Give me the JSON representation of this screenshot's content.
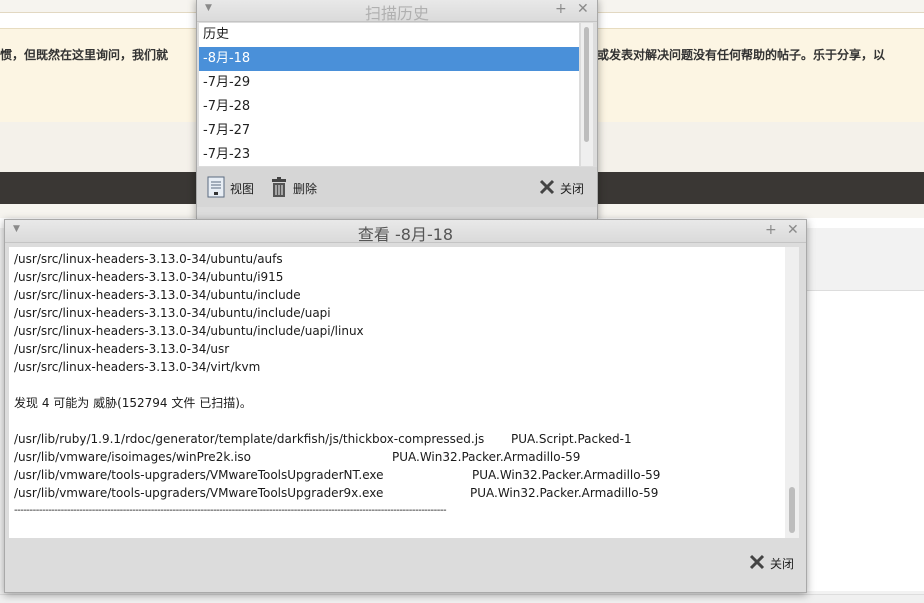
{
  "background": {
    "notice_left": "惯，但既然在这里询问，我们就",
    "notice_right": "或发表对解决问题没有任何帮助的帖子。乐于分享，以"
  },
  "history_window": {
    "title": "扫描历史",
    "items": [
      {
        "label": "历史",
        "selected": false
      },
      {
        "label": "-8月-18",
        "selected": true
      },
      {
        "label": "-7月-29",
        "selected": false
      },
      {
        "label": "-7月-28",
        "selected": false
      },
      {
        "label": "-7月-27",
        "selected": false
      },
      {
        "label": "-7月-23",
        "selected": false
      }
    ],
    "view_label": "视图",
    "delete_label": "删除",
    "close_label": "关闭"
  },
  "view_window": {
    "title": "查看 -8月-18",
    "lines": [
      "/usr/src/linux-headers-3.13.0-34/ubuntu/aufs",
      "/usr/src/linux-headers-3.13.0-34/ubuntu/i915",
      "/usr/src/linux-headers-3.13.0-34/ubuntu/include",
      "/usr/src/linux-headers-3.13.0-34/ubuntu/include/uapi",
      "/usr/src/linux-headers-3.13.0-34/ubuntu/include/uapi/linux",
      "/usr/src/linux-headers-3.13.0-34/usr",
      "/usr/src/linux-headers-3.13.0-34/virt/kvm",
      "",
      "发现 4 可能为 威胁(152794 文件 已扫描)。",
      ""
    ],
    "threats": [
      {
        "path": "/usr/lib/ruby/1.9.1/rdoc/generator/template/darkfish/js/thickbox-compressed.js",
        "name": "PUA.Script.Packed-1"
      },
      {
        "path": "/usr/lib/vmware/isoimages/winPre2k.iso",
        "name": "PUA.Win32.Packer.Armadillo-59"
      },
      {
        "path": "/usr/lib/vmware/tools-upgraders/VMwareToolsUpgraderNT.exe",
        "name": "PUA.Win32.Packer.Armadillo-59"
      },
      {
        "path": "/usr/lib/vmware/tools-upgraders/VMwareToolsUpgrader9x.exe",
        "name": "PUA.Win32.Packer.Armadillo-59"
      }
    ],
    "separator": "-------------------------------------------------------------------------------------------------------------------------------------------",
    "close_label": "关闭"
  },
  "colors": {
    "selection": "#4a90d9",
    "dark_bar": "#3a3734",
    "notice_bg": "#fcf5e3"
  }
}
